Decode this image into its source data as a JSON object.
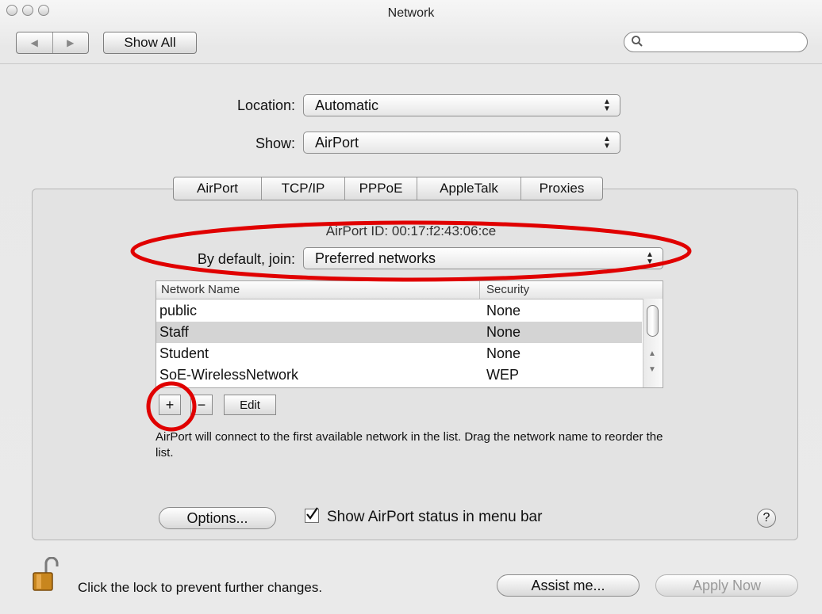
{
  "window": {
    "title": "Network"
  },
  "toolbar": {
    "back_glyph": "◀",
    "forward_glyph": "▶",
    "show_all_label": "Show All",
    "search_placeholder": ""
  },
  "location": {
    "label": "Location:",
    "value": "Automatic"
  },
  "show": {
    "label": "Show:",
    "value": "AirPort"
  },
  "tabs": [
    {
      "label": "AirPort"
    },
    {
      "label": "TCP/IP"
    },
    {
      "label": "PPPoE"
    },
    {
      "label": "AppleTalk"
    },
    {
      "label": "Proxies"
    }
  ],
  "airport_id_text": "AirPort ID:   00:17:f2:43:06:ce",
  "default_join": {
    "label": "By default, join:",
    "value": "Preferred networks"
  },
  "networks": {
    "columns": [
      "Network Name",
      "Security"
    ],
    "rows": [
      {
        "name": "public",
        "security": "None"
      },
      {
        "name": "Staff",
        "security": "None"
      },
      {
        "name": "Student",
        "security": "None"
      },
      {
        "name": "SoE-WirelessNetwork",
        "security": "WEP"
      }
    ],
    "selected_index": 1
  },
  "list_buttons": {
    "add": "+",
    "remove": "−",
    "edit": "Edit"
  },
  "note": "AirPort will connect to the first available network in the list. Drag the network name to reorder the list.",
  "options_label": "Options...",
  "status_checkbox": {
    "label": "Show AirPort status in menu bar",
    "checked": true
  },
  "help_glyph": "?",
  "lock_text": "Click the lock to prevent further changes.",
  "assist_label": "Assist me...",
  "apply_label": "Apply Now",
  "colors": {
    "annotation_red": "#e00000",
    "selected_row": "#d4d4d4"
  }
}
